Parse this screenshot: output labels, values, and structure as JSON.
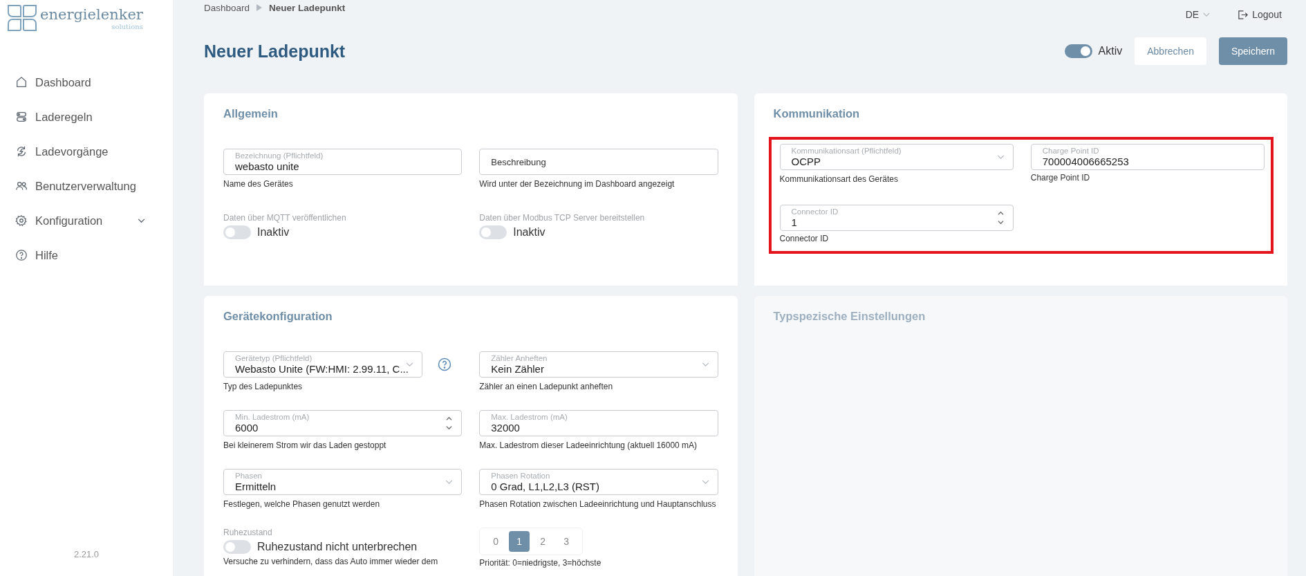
{
  "brand": {
    "name": "energielenker",
    "tagline": "solutions"
  },
  "sidebar": {
    "items": [
      {
        "label": "Dashboard",
        "kind": "home",
        "expandable": false
      },
      {
        "label": "Laderegeln",
        "kind": "rules",
        "expandable": false
      },
      {
        "label": "Ladevorgänge",
        "kind": "sync",
        "expandable": false
      },
      {
        "label": "Benutzerverwaltung",
        "kind": "users",
        "expandable": false
      },
      {
        "label": "Konfiguration",
        "kind": "settings",
        "expandable": true
      },
      {
        "label": "Hilfe",
        "kind": "help",
        "expandable": false
      }
    ],
    "version": "2.21.0"
  },
  "header": {
    "breadcrumb": [
      "Dashboard",
      "Neuer Ladepunkt"
    ],
    "language": "DE",
    "logout": "Logout"
  },
  "page": {
    "title": "Neuer Ladepunkt",
    "active_toggle": {
      "label": "Aktiv",
      "on": true
    },
    "buttons": [
      {
        "label": "Abbrechen",
        "kind": "secondary"
      },
      {
        "label": "Speichern",
        "kind": "primary"
      }
    ]
  },
  "sections": [
    {
      "title": "Allgemein",
      "disabled": false,
      "fields": [
        {
          "kind": "text",
          "label": "Bezeichnung (Pflichtfeld)",
          "value": "webasto unite",
          "hint": "Name des Gerätes"
        },
        {
          "kind": "text",
          "placeholder": "Beschreibung",
          "hint": "Wird unter der Bezeichnung im Dashboard angezeigt"
        },
        {
          "kind": "toggle",
          "label": "Daten über MQTT veröffentlichen",
          "on": false,
          "text": "Inaktiv"
        },
        {
          "kind": "toggle",
          "label": "Daten über Modbus TCP Server bereitstellen",
          "on": false,
          "text": "Inaktiv"
        }
      ]
    },
    {
      "title": "Kommunikation",
      "disabled": false,
      "highlighted": true,
      "fields": [
        {
          "kind": "select",
          "label": "Kommunikationsart (Pflichtfeld)",
          "value": "OCPP",
          "hint": "Kommunikationsart des Gerätes"
        },
        {
          "kind": "text",
          "label": "Charge Point ID",
          "value": "700004006665253",
          "hint": "Charge Point ID"
        },
        {
          "kind": "number",
          "label": "Connector ID",
          "value": "1",
          "hint": "Connector ID"
        }
      ]
    },
    {
      "title": "Gerätekonfiguration",
      "disabled": false,
      "fields": [
        {
          "kind": "select",
          "label": "Gerätetyp (Pflichtfeld)",
          "value": "Webasto Unite (FW:HMI: 2.99.11, C...",
          "hint": "Typ des Ladepunktes",
          "help": true
        },
        {
          "kind": "select",
          "label": "Zähler Anheften",
          "value": "Kein Zähler",
          "hint": "Zähler an einen Ladepunkt anheften"
        },
        {
          "kind": "number",
          "label": "Min. Ladestrom (mA)",
          "value": "6000",
          "hint": "Bei kleinerem Strom wir das Laden gestoppt"
        },
        {
          "kind": "text",
          "label": "Max. Ladestrom (mA)",
          "value": "32000",
          "hint": "Max. Ladestrom dieser Ladeeinrichtung (aktuell 16000 mA)"
        },
        {
          "kind": "select",
          "label": "Phasen",
          "value": "Ermitteln",
          "hint": "Festlegen, welche Phasen genutzt werden"
        },
        {
          "kind": "select",
          "label": "Phasen Rotation",
          "value": "0 Grad, L1,L2,L3 (RST)",
          "hint": "Phasen Rotation zwischen Ladeeinrichtung und Hauptanschluss"
        },
        {
          "kind": "toggle",
          "label": "Ruhezustand",
          "on": false,
          "text": "Ruhezustand nicht unterbrechen",
          "hint": "Versuche zu verhindern, dass das Auto immer wieder dem"
        },
        {
          "kind": "segmented",
          "options": [
            {
              "label": "0",
              "selected": false
            },
            {
              "label": "1",
              "selected": true
            },
            {
              "label": "2",
              "selected": false
            },
            {
              "label": "3",
              "selected": false
            }
          ],
          "hint": "Priorität: 0=niedrigste, 3=höchste"
        }
      ]
    },
    {
      "title": "Typspezische Einstellungen",
      "disabled": true
    }
  ]
}
